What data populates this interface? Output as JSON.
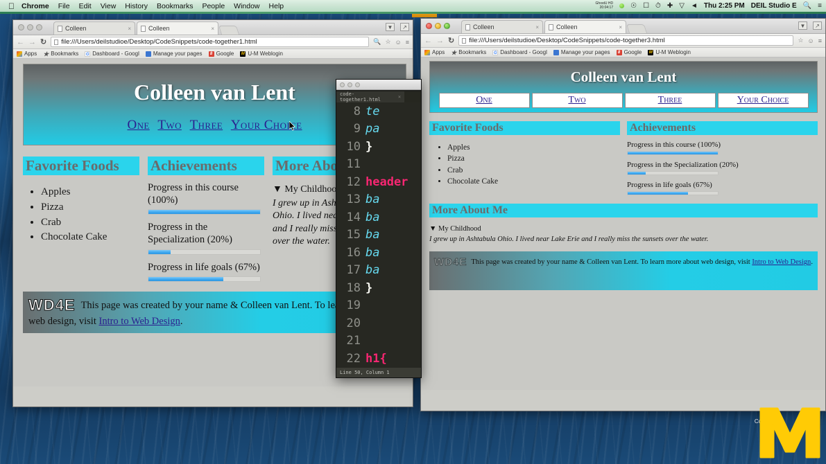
{
  "menubar": {
    "apple_icon": "apple-icon",
    "items": [
      "Chrome",
      "File",
      "Edit",
      "View",
      "History",
      "Bookmarks",
      "People",
      "Window",
      "Help"
    ],
    "status_tiny_line1": "GhostU HD",
    "status_tiny_line2": "20:04:17",
    "icons": [
      "lock-icon",
      "airplay-icon",
      "screen-icon",
      "timemachine-icon",
      "bluetooth-icon",
      "wifi-icon",
      "volume-icon"
    ],
    "clock": "Thu 2:25 PM",
    "user": "DEIL Studio E",
    "search_icon": "search-icon",
    "notifications_icon": "notification-center-icon"
  },
  "browser_chrome": {
    "tab_label": "Colleen",
    "tab_close": "×",
    "bookmarks": [
      {
        "label": "Apps",
        "icon": "apps-grid-icon"
      },
      {
        "label": "Bookmarks",
        "icon": "star-icon"
      },
      {
        "label": "Dashboard - Googl",
        "icon": "google-icon"
      },
      {
        "label": "Manage your pages",
        "icon": "pages-icon"
      },
      {
        "label": "Google",
        "icon": "google-plus-icon"
      },
      {
        "label": "U-M Weblogin",
        "icon": "umich-icon"
      }
    ],
    "menu_icon": "hamburger-menu-icon",
    "back_icon": "back-arrow-icon",
    "forward_icon": "forward-arrow-icon",
    "reload_icon": "reload-icon",
    "zoom_icon": "zoom-icon",
    "bookmark_star_icon": "star-outline-icon",
    "user_icon": "user-icon",
    "minimize_icon": "minimize-icon",
    "fullscreen_icon": "fullscreen-icon"
  },
  "left_window": {
    "url": "file:///Users/deilstudioe/Desktop/CodeSnippets/code-together1.html",
    "page": {
      "title": "Colleen van Lent",
      "nav": [
        "One",
        "Two",
        "Three",
        "Your Choice"
      ],
      "sections": {
        "foods_heading": "Favorite Foods",
        "foods": [
          "Apples",
          "Pizza",
          "Crab",
          "Chocolate Cake"
        ],
        "achievements_heading": "Achievements",
        "progress": [
          {
            "label": "Progress in this course (100%)",
            "percent": 100
          },
          {
            "label": "Progress in the Specialization (20%)",
            "percent": 20
          },
          {
            "label": "Progress in life goals (67%)",
            "percent": 67
          }
        ],
        "about_heading": "More About Me",
        "childhood_summary": "My Childhood",
        "childhood_marker": "▼",
        "childhood_body": "I grew up in Ashtabula Ohio. I lived near Lake Erie and I really miss the sunsets over the water."
      },
      "footer": {
        "logo_text": "WD4E",
        "text_before": "This page was created by your name & Colleen van Lent. To learn more about web design, visit ",
        "link": "Intro to Web Design",
        "text_after": "."
      }
    }
  },
  "right_window": {
    "url": "file:///Users/deilstudioe/Desktop/CodeSnippets/code-together3.html",
    "page": {
      "title": "Colleen van Lent",
      "nav": [
        "One",
        "Two",
        "Three",
        "Your Choice"
      ],
      "sections": {
        "foods_heading": "Favorite Foods",
        "foods": [
          "Apples",
          "Pizza",
          "Crab",
          "Chocolate Cake"
        ],
        "achievements_heading": "Achievements",
        "progress": [
          {
            "label": "Progress in this course (100%)",
            "percent": 100
          },
          {
            "label": "Progress in the Specialization (20%)",
            "percent": 20
          },
          {
            "label": "Progress in life goals (67%)",
            "percent": 67
          }
        ],
        "about_heading": "More About Me",
        "childhood_summary": "My Childhood",
        "childhood_marker": "▼",
        "childhood_body": "I grew up in Ashtabula Ohio. I lived near Lake Erie and I really miss the sunsets over the water."
      },
      "footer": {
        "logo_text": "WD4E",
        "text_before": "This page was created by your name & Colleen van Lent. To learn more about web design, visit ",
        "link": "Intro to Web Design",
        "text_after": "."
      }
    }
  },
  "editor": {
    "tab_label": "code-together1.html",
    "tab_close": "×",
    "status": "Line 50, Column 1",
    "lines": [
      {
        "n": "8",
        "kind": "prop",
        "text": "te"
      },
      {
        "n": "9",
        "kind": "prop",
        "text": "pa"
      },
      {
        "n": "10",
        "kind": "brace",
        "text": "}"
      },
      {
        "n": "11",
        "kind": "blank",
        "text": ""
      },
      {
        "n": "12",
        "kind": "sel",
        "text": "header"
      },
      {
        "n": "13",
        "kind": "prop",
        "text": "ba"
      },
      {
        "n": "14",
        "kind": "prop",
        "text": "ba"
      },
      {
        "n": "15",
        "kind": "prop",
        "text": "ba"
      },
      {
        "n": "16",
        "kind": "prop",
        "text": "ba"
      },
      {
        "n": "17",
        "kind": "prop",
        "text": "ba"
      },
      {
        "n": "18",
        "kind": "brace",
        "text": "}"
      },
      {
        "n": "19",
        "kind": "blank",
        "text": ""
      },
      {
        "n": "20",
        "kind": "blank",
        "text": ""
      },
      {
        "n": "21",
        "kind": "blank",
        "text": ""
      },
      {
        "n": "22",
        "kind": "sel",
        "text": "h1{"
      }
    ]
  },
  "desktop": {
    "michigan_logo": "M",
    "caption": "Code"
  },
  "colors": {
    "cyan_highlight": "#2ad4ec",
    "link_blue": "#2a1f8f",
    "progress_blue": "#3da8f0",
    "michigan_yellow": "#ffcb05",
    "michigan_blue": "#00274c",
    "editor_bg": "#272822",
    "editor_selector": "#f92672",
    "editor_property": "#66d9ef"
  }
}
